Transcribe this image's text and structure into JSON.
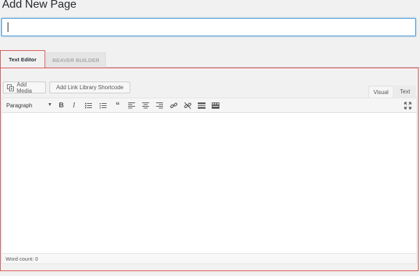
{
  "page": {
    "title": "Add New Page"
  },
  "title_input": {
    "value": ""
  },
  "tabs": [
    {
      "label": "Text Editor",
      "active": true
    },
    {
      "label": "BEAVER BUILDER",
      "active": false
    }
  ],
  "media_buttons": {
    "add_media": "Add Media",
    "add_link_shortcode": "Add Link Library Shortcode"
  },
  "editor_modes": {
    "visual": "Visual",
    "text": "Text",
    "active": "Visual"
  },
  "toolbar": {
    "format_select": "Paragraph",
    "icons": [
      "bold-icon",
      "italic-icon",
      "bullet-list-icon",
      "numbered-list-icon",
      "blockquote-icon",
      "align-left-icon",
      "align-center-icon",
      "align-right-icon",
      "insert-link-icon",
      "remove-link-icon",
      "read-more-icon",
      "toolbar-toggle-icon",
      "fullscreen-icon"
    ]
  },
  "status": {
    "word_count": "Word count: 0"
  },
  "colors": {
    "focus_border": "#5b9dd9",
    "highlight_border": "#d9534f",
    "background": "#f1f1f1"
  }
}
